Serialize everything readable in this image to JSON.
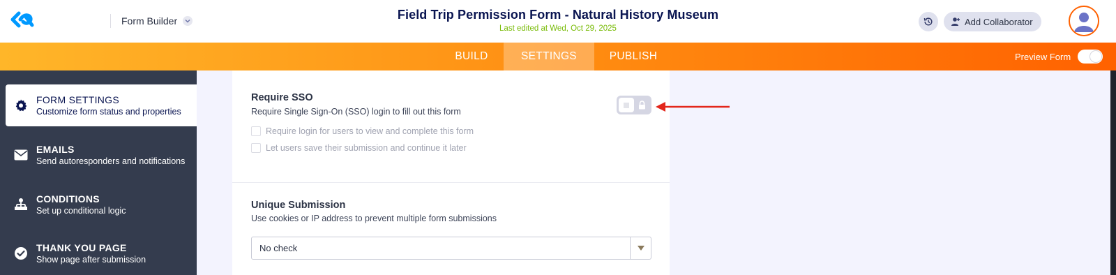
{
  "header": {
    "app_switch_label": "Form Builder",
    "form_title": "Field Trip Permission Form - Natural History Museum",
    "last_edited": "Last edited at Wed, Oct 29, 2025",
    "collaborator_label": "Add Collaborator",
    "icons": [
      "jotform-logo-icon",
      "chevron-down-icon",
      "history-icon",
      "add-user-icon",
      "user-avatar-icon"
    ]
  },
  "nav": {
    "tabs": [
      {
        "label": "BUILD",
        "active": false
      },
      {
        "label": "SETTINGS",
        "active": true
      },
      {
        "label": "PUBLISH",
        "active": false
      }
    ],
    "preview_label": "Preview Form",
    "preview_enabled": false
  },
  "sidebar": {
    "items": [
      {
        "title": "FORM SETTINGS",
        "desc": "Customize form status and properties",
        "icon": "gear-icon",
        "active": true
      },
      {
        "title": "EMAILS",
        "desc": "Send autoresponders and notifications",
        "icon": "envelope-icon",
        "active": false
      },
      {
        "title": "CONDITIONS",
        "desc": "Set up conditional logic",
        "icon": "sitemap-icon",
        "active": false
      },
      {
        "title": "THANK YOU PAGE",
        "desc": "Show page after submission",
        "icon": "check-circle-icon",
        "active": false
      }
    ]
  },
  "settings": {
    "sso": {
      "title": "Require SSO",
      "desc": "Require Single Sign-On (SSO) login to fill out this form",
      "enabled": false,
      "locked": true,
      "options": [
        {
          "label": "Require login for users to view and complete this form",
          "checked": false,
          "disabled": true
        },
        {
          "label": "Let users save their submission and continue it later",
          "checked": false,
          "disabled": true
        }
      ]
    },
    "unique": {
      "title": "Unique Submission",
      "desc": "Use cookies or IP address to prevent multiple form submissions",
      "selected": "No check"
    }
  },
  "colors": {
    "accent_orange": "#ff6100",
    "nav_gradient_start": "#ffb629",
    "sidebar_bg": "#343c4e",
    "title_navy": "#0a1551",
    "edited_green": "#78bb07",
    "annotation_arrow": "#e3261b"
  }
}
